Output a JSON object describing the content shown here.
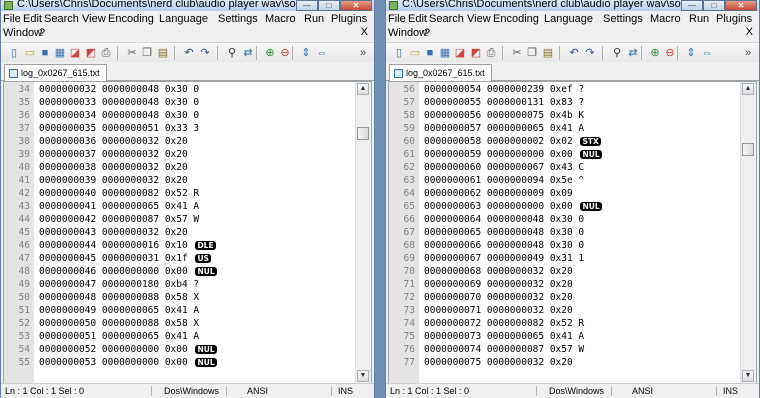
{
  "windows": [
    {
      "title": "C:\\Users\\Chris\\Documents\\nerd club\\audio player wav\\sourceboos...",
      "menu": [
        "File",
        "Edit",
        "Search",
        "View",
        "Encoding",
        "Language",
        "Settings",
        "Macro",
        "Run",
        "Plugins",
        "Window",
        "?"
      ],
      "close_x": "X",
      "tab": "log_0x0267_615.txt",
      "lines": [
        {
          "n": "34",
          "t": "0000000032 0000000048 0x30 0"
        },
        {
          "n": "35",
          "t": "0000000033 0000000048 0x30 0"
        },
        {
          "n": "36",
          "t": "0000000034 0000000048 0x30 0"
        },
        {
          "n": "37",
          "t": "0000000035 0000000051 0x33 3"
        },
        {
          "n": "38",
          "t": "0000000036 0000000032 0x20"
        },
        {
          "n": "39",
          "t": "0000000037 0000000032 0x20"
        },
        {
          "n": "40",
          "t": "0000000038 0000000032 0x20"
        },
        {
          "n": "41",
          "t": "0000000039 0000000032 0x20"
        },
        {
          "n": "42",
          "t": "0000000040 0000000082 0x52 R"
        },
        {
          "n": "43",
          "t": "0000000041 0000000065 0x41 A"
        },
        {
          "n": "44",
          "t": "0000000042 0000000087 0x57 W"
        },
        {
          "n": "45",
          "t": "0000000043 0000000032 0x20"
        },
        {
          "n": "46",
          "t": "0000000044 0000000016 0x10",
          "c": "DLE"
        },
        {
          "n": "47",
          "t": "0000000045 0000000031 0x1f",
          "c": "US"
        },
        {
          "n": "48",
          "t": "0000000046 0000000000 0x00",
          "c": "NUL"
        },
        {
          "n": "49",
          "t": "0000000047 0000000180 0xb4 ?"
        },
        {
          "n": "50",
          "t": "0000000048 0000000088 0x58 X"
        },
        {
          "n": "51",
          "t": "0000000049 0000000065 0x41 A"
        },
        {
          "n": "52",
          "t": "0000000050 0000000088 0x58 X"
        },
        {
          "n": "53",
          "t": "0000000051 0000000065 0x41 A"
        },
        {
          "n": "54",
          "t": "0000000052 0000000000 0x00",
          "c": "NUL"
        },
        {
          "n": "55",
          "t": "0000000053 0000000000 0x00",
          "c": "NUL"
        }
      ],
      "scroll_position": 0.12,
      "status": {
        "pos": "Ln : 1   Col : 1   Sel : 0",
        "eol": "Dos\\Windows",
        "enc": "ANSI",
        "mode": "INS"
      }
    },
    {
      "title": "C:\\Users\\Chris\\Documents\\nerd club\\audio player wav\\sourceboos...",
      "menu": [
        "File",
        "Edit",
        "Search",
        "View",
        "Encoding",
        "Language",
        "Settings",
        "Macro",
        "Run",
        "Plugins",
        "Window",
        "?"
      ],
      "close_x": "X",
      "tab": "log_0x0267_615.txt",
      "lines": [
        {
          "n": "56",
          "t": "0000000054 0000000239 0xef ?"
        },
        {
          "n": "57",
          "t": "0000000055 0000000131 0x83 ?"
        },
        {
          "n": "58",
          "t": "0000000056 0000000075 0x4b K"
        },
        {
          "n": "59",
          "t": "0000000057 0000000065 0x41 A"
        },
        {
          "n": "60",
          "t": "0000000058 0000000002 0x02",
          "c": "STX"
        },
        {
          "n": "61",
          "t": "0000000059 0000000000 0x00",
          "c": "NUL"
        },
        {
          "n": "62",
          "t": "0000000060 0000000067 0x43 C"
        },
        {
          "n": "63",
          "t": "0000000061 0000000094 0x5e ^"
        },
        {
          "n": "64",
          "t": "0000000062 0000000009 0x09"
        },
        {
          "n": "65",
          "t": "0000000063 0000000000 0x00",
          "c": "NUL"
        },
        {
          "n": "66",
          "t": "0000000064 0000000048 0x30 0"
        },
        {
          "n": "67",
          "t": "0000000065 0000000048 0x30 0"
        },
        {
          "n": "68",
          "t": "0000000066 0000000048 0x30 0"
        },
        {
          "n": "69",
          "t": "0000000067 0000000049 0x31 1"
        },
        {
          "n": "70",
          "t": "0000000068 0000000032 0x20"
        },
        {
          "n": "71",
          "t": "0000000069 0000000032 0x20"
        },
        {
          "n": "72",
          "t": "0000000070 0000000032 0x20"
        },
        {
          "n": "73",
          "t": "0000000071 0000000032 0x20"
        },
        {
          "n": "74",
          "t": "0000000072 0000000082 0x52 R"
        },
        {
          "n": "75",
          "t": "0000000073 0000000065 0x41 A"
        },
        {
          "n": "76",
          "t": "0000000074 0000000087 0x57 W"
        },
        {
          "n": "77",
          "t": "0000000075 0000000032 0x20"
        }
      ],
      "scroll_position": 0.18,
      "status": {
        "pos": "Ln : 1   Col : 1   Sel : 0",
        "eol": "Dos\\Windows",
        "enc": "ANSI",
        "mode": "INS"
      }
    }
  ],
  "toolbar_icons": [
    "new-file-icon",
    "open-file-icon",
    "save-icon",
    "save-all-icon",
    "close-icon",
    "close-all-icon",
    "print-icon",
    "cut-icon",
    "copy-icon",
    "paste-icon",
    "undo-icon",
    "redo-icon",
    "find-icon",
    "replace-icon",
    "zoom-in-icon",
    "zoom-out-icon",
    "sync-vertical-icon",
    "sync-horizontal-icon",
    "toolbar-overflow-icon"
  ],
  "colors": {
    "ctrl_badge_bg": "#000000",
    "gutter": "#e4e4e4",
    "line_number": "#808080"
  }
}
